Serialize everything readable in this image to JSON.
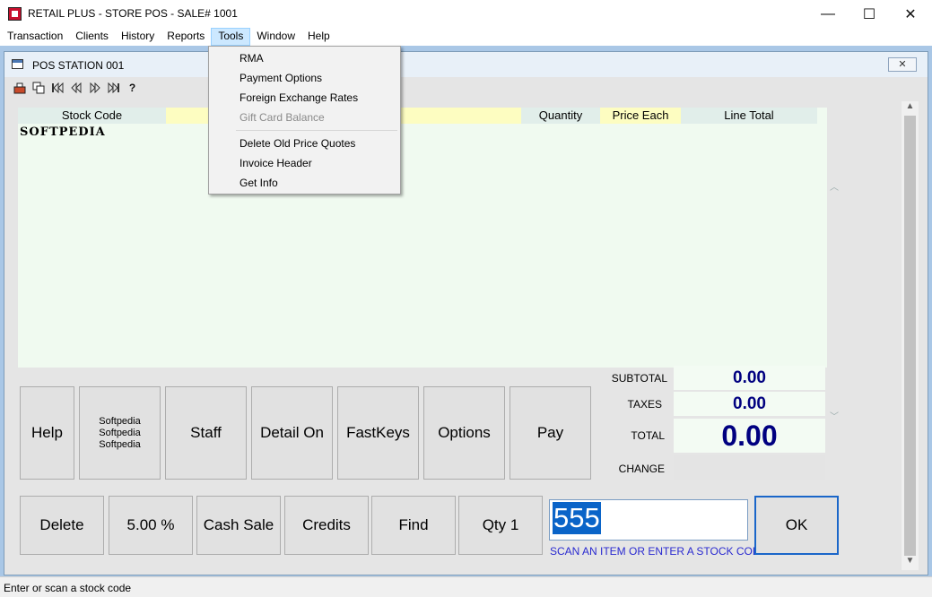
{
  "window": {
    "title": "RETAIL PLUS  -  STORE POS  -  SALE# 1001",
    "minimize": "—",
    "maximize": "☐",
    "close": "✕"
  },
  "menu": [
    "Transaction",
    "Clients",
    "History",
    "Reports",
    "Tools",
    "Window",
    "Help"
  ],
  "active_menu": "Tools",
  "tools_menu": {
    "items": [
      "RMA",
      "Payment Options",
      "Foreign Exchange Rates",
      "Gift Card Balance",
      "Delete Old Price Quotes",
      "Invoice Header",
      "Get Info"
    ],
    "disabled": "Gift Card Balance"
  },
  "child_window": {
    "title": "POS STATION 001",
    "close": "✕"
  },
  "toolbar_icons": [
    "register-icon",
    "copy-icon",
    "first-record-icon",
    "previous-record-icon",
    "next-record-icon",
    "last-record-icon",
    "help-icon"
  ],
  "grid": {
    "columns": [
      "Stock Code",
      "",
      "",
      "Quantity",
      "Price Each",
      "Line Total"
    ],
    "rows": [
      [
        "SOFTPEDIA"
      ]
    ]
  },
  "totals": {
    "subtotal_label": "SUBTOTAL",
    "subtotal": "0.00",
    "taxes_label": "TAXES",
    "taxes": "0.00",
    "total_label": "TOTAL",
    "total": "0.00",
    "change_label": "CHANGE",
    "change": ""
  },
  "buttons_row1": {
    "help": "Help",
    "custom_line1": "Softpedia",
    "custom_line2": "Softpedia",
    "custom_line3": "Softpedia",
    "staff": "Staff",
    "detail": "Detail On",
    "fastkeys": "FastKeys",
    "options": "Options",
    "pay": "Pay"
  },
  "buttons_row2": {
    "delete": "Delete",
    "discount": "5.00 %",
    "cash_sale": "Cash Sale",
    "credits": "Credits",
    "find": "Find",
    "qty": "Qty 1"
  },
  "scan": {
    "value": "555",
    "hint": "SCAN AN ITEM OR ENTER A STOCK CODE",
    "ok": "OK"
  },
  "status": "Enter or scan a stock code",
  "colors": {
    "mdi_background": "#a9c7e6",
    "grid_background": "#f0faf0",
    "header_highlight": "#fdfdc1",
    "total_text": "#000080",
    "selection": "#0a64c8"
  }
}
